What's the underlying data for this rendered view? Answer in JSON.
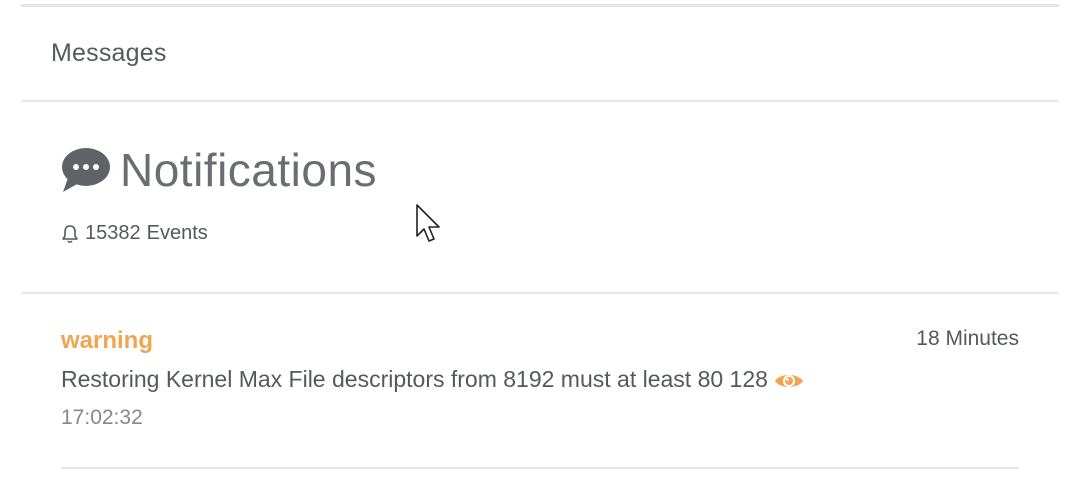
{
  "messages": {
    "title": "Messages"
  },
  "notifications": {
    "title": "Notifications",
    "icon": "speech-bubble-icon",
    "events_icon": "bell-icon",
    "events_count": "15382",
    "events_label": "Events"
  },
  "events": [
    {
      "level": "warning",
      "level_color": "#f0a552",
      "ago": "18 Minutes",
      "message": "Restoring Kernel Max File descriptors from 8192 must at least 80 128",
      "action_icon": "eye-icon",
      "time": "17:02:32"
    }
  ],
  "colors": {
    "border": "#e6e6e6",
    "text": "#55595d",
    "muted": "#85898c",
    "accent": "#f0a552"
  }
}
